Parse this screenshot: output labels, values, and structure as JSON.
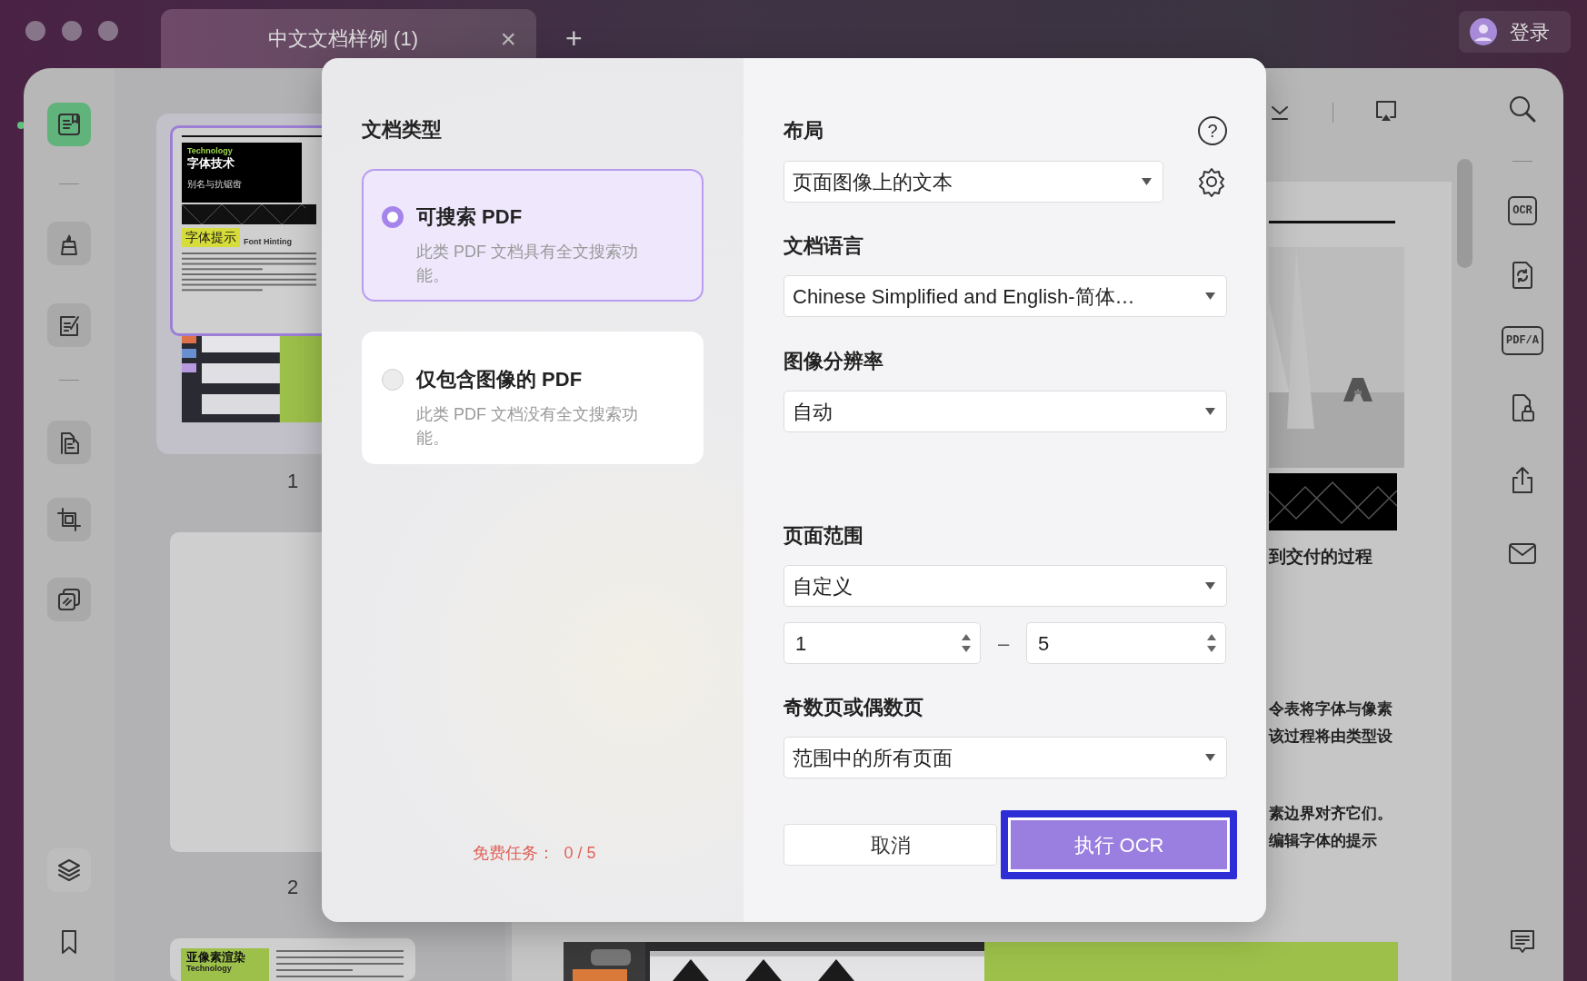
{
  "window": {
    "tabs": [
      {
        "label": "中文文档样例 (1)",
        "close": "×",
        "selected": true
      }
    ],
    "new_tab": "+",
    "account": "登录"
  },
  "left_toolbar": [
    {
      "selected": true
    },
    {
      "selected": false
    },
    {
      "selected": false
    },
    {
      "selected": false
    },
    {
      "selected": false
    },
    {
      "selected": false
    },
    {
      "selected": false
    },
    {
      "selected": false
    }
  ],
  "thumbnails": [
    {
      "page": "1",
      "selected": true,
      "texts": [
        "Technology",
        "字体技术",
        "别名与抗锯齿",
        "字体提示",
        "Font Hinting"
      ]
    },
    {
      "page": "2",
      "selected": false
    },
    {
      "selected": false,
      "texts": [
        "亚像素渲染",
        "Technology"
      ]
    }
  ],
  "document": {
    "heading": "到交付的过程",
    "lines": [
      "令表将字体与像素",
      "该过程将由类型设",
      "素边界对齐它们。",
      "编辑字体的提示"
    ]
  },
  "right_toolbar": [
    {
      "kind": "icon"
    },
    {
      "kind": "label",
      "label": "OCR"
    },
    {
      "kind": "icon"
    },
    {
      "kind": "label",
      "label": "PDF/A"
    },
    {
      "kind": "icon"
    },
    {
      "kind": "icon"
    },
    {
      "kind": "icon"
    },
    {
      "kind": "icon"
    }
  ],
  "ocr_dialog": {
    "document_type": {
      "label": "文档类型",
      "options": [
        {
          "title": "可搜索 PDF",
          "description": "此类 PDF 文档具有全文搜索功能。",
          "selected": true
        },
        {
          "title": "仅包含图像的 PDF",
          "description": "此类 PDF 文档没有全文搜索功能。",
          "selected": false
        }
      ]
    },
    "free_tasks": "免费任务：  0 / 5",
    "layout": {
      "label": "布局",
      "help": "?",
      "value": "页面图像上的文本"
    },
    "language": {
      "label": "文档语言",
      "value": "Chinese Simplified and English-简体…"
    },
    "resolution": {
      "label": "图像分辨率",
      "value": "自动"
    },
    "page_range": {
      "label": "页面范围",
      "value": "自定义",
      "from": "1",
      "separator": "–",
      "to": "5"
    },
    "odd_even": {
      "label": "奇数页或偶数页",
      "value": "范围中的所有页面"
    },
    "buttons": [
      {
        "label": "取消",
        "kind": "secondary",
        "focused": false
      },
      {
        "label": "执行 OCR",
        "kind": "primary",
        "focused": true
      }
    ]
  }
}
